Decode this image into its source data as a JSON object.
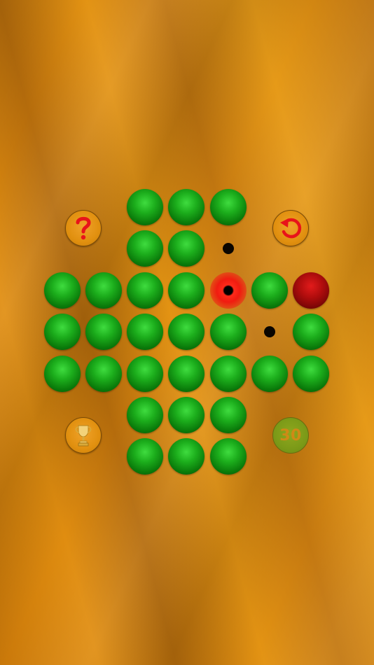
{
  "board": {
    "cols": [
      63,
      122,
      181,
      240,
      300,
      359,
      418
    ],
    "rows": [
      270,
      329,
      389,
      448,
      508,
      567,
      626
    ],
    "cells": [
      {
        "r": 0,
        "c": 2,
        "state": "peg"
      },
      {
        "r": 0,
        "c": 3,
        "state": "peg"
      },
      {
        "r": 0,
        "c": 4,
        "state": "peg"
      },
      {
        "r": 1,
        "c": 2,
        "state": "peg"
      },
      {
        "r": 1,
        "c": 3,
        "state": "peg"
      },
      {
        "r": 1,
        "c": 4,
        "state": "empty"
      },
      {
        "r": 2,
        "c": 0,
        "state": "peg"
      },
      {
        "r": 2,
        "c": 1,
        "state": "peg"
      },
      {
        "r": 2,
        "c": 2,
        "state": "peg"
      },
      {
        "r": 2,
        "c": 3,
        "state": "peg"
      },
      {
        "r": 2,
        "c": 4,
        "state": "selected"
      },
      {
        "r": 2,
        "c": 5,
        "state": "peg"
      },
      {
        "r": 2,
        "c": 6,
        "state": "peg-red"
      },
      {
        "r": 3,
        "c": 0,
        "state": "peg"
      },
      {
        "r": 3,
        "c": 1,
        "state": "peg"
      },
      {
        "r": 3,
        "c": 2,
        "state": "peg"
      },
      {
        "r": 3,
        "c": 3,
        "state": "peg"
      },
      {
        "r": 3,
        "c": 4,
        "state": "peg"
      },
      {
        "r": 3,
        "c": 5,
        "state": "empty"
      },
      {
        "r": 3,
        "c": 6,
        "state": "peg"
      },
      {
        "r": 4,
        "c": 0,
        "state": "peg"
      },
      {
        "r": 4,
        "c": 1,
        "state": "peg"
      },
      {
        "r": 4,
        "c": 2,
        "state": "peg"
      },
      {
        "r": 4,
        "c": 3,
        "state": "peg"
      },
      {
        "r": 4,
        "c": 4,
        "state": "peg"
      },
      {
        "r": 4,
        "c": 5,
        "state": "peg"
      },
      {
        "r": 4,
        "c": 6,
        "state": "peg"
      },
      {
        "r": 5,
        "c": 2,
        "state": "peg"
      },
      {
        "r": 5,
        "c": 3,
        "state": "peg"
      },
      {
        "r": 5,
        "c": 4,
        "state": "peg"
      },
      {
        "r": 6,
        "c": 2,
        "state": "peg"
      },
      {
        "r": 6,
        "c": 3,
        "state": "peg"
      },
      {
        "r": 6,
        "c": 4,
        "state": "peg"
      }
    ]
  },
  "controls": {
    "help_icon": "question-mark-icon",
    "restart_icon": "restart-arrow-icon",
    "trophy_icon": "trophy-icon",
    "pegs_remaining": "30"
  },
  "colors": {
    "peg": "#1cae1c",
    "peg_red": "#b00d0d",
    "selected_glow": "#f01c10",
    "icon_red": "#e8141a",
    "counter_bg": "#7b9a18",
    "counter_text": "#cf8a16"
  }
}
